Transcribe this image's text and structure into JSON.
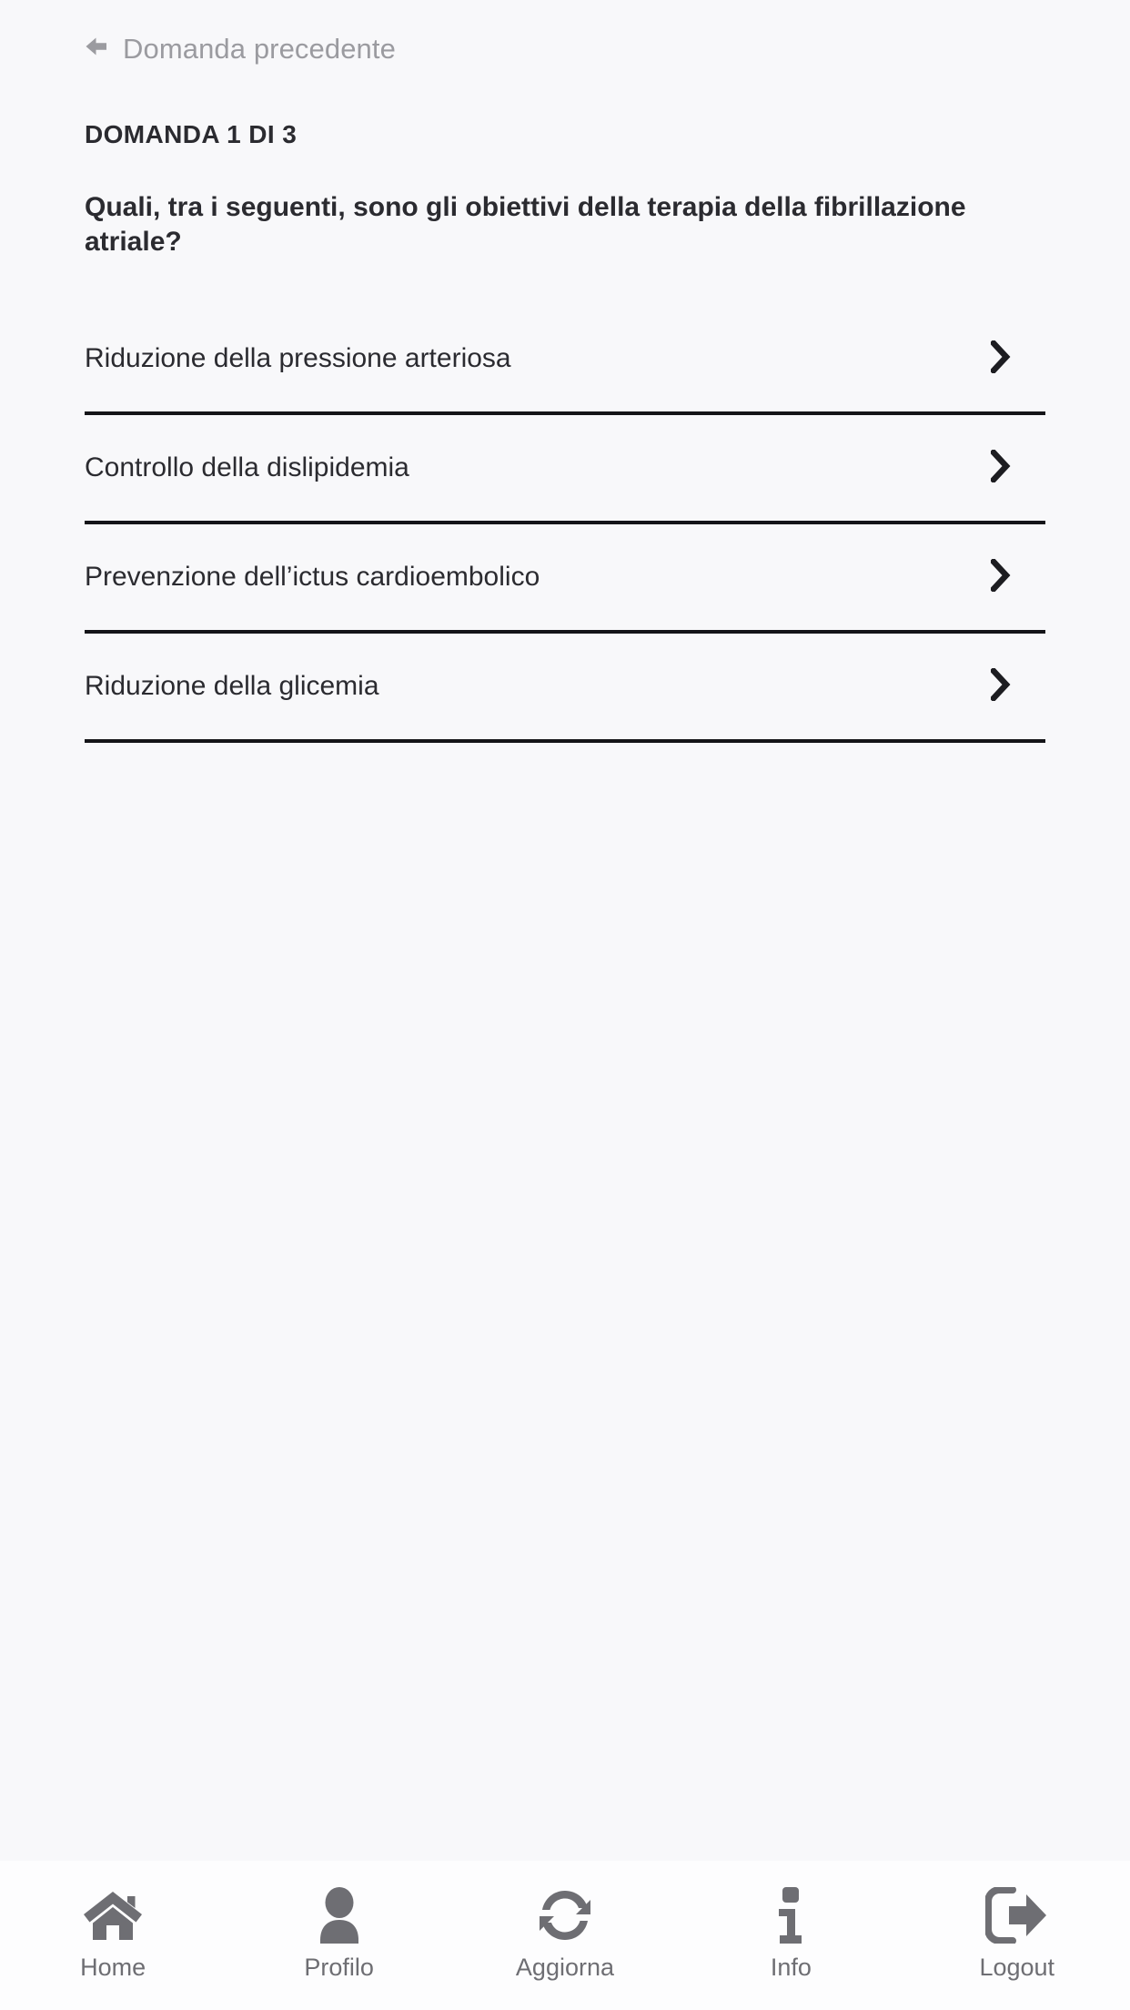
{
  "header": {
    "back_icon": "arrow-left-icon",
    "back_label": "Domanda precedente"
  },
  "question": {
    "counter": "DOMANDA 1 DI 3",
    "text": "Quali, tra i seguenti, sono gli obiettivi della terapia della fibrillazione atriale?"
  },
  "options": [
    {
      "label": "Riduzione della pressione arteriosa",
      "chevron_icon": "chevron-right-icon"
    },
    {
      "label": "Controllo della dislipidemia",
      "chevron_icon": "chevron-right-icon"
    },
    {
      "label": "Prevenzione dell’ictus cardioembolico",
      "chevron_icon": "chevron-right-icon"
    },
    {
      "label": "Riduzione della glicemia",
      "chevron_icon": "chevron-right-icon"
    }
  ],
  "bottom_nav": [
    {
      "label": "Home",
      "icon": "home-icon"
    },
    {
      "label": "Profilo",
      "icon": "person-icon"
    },
    {
      "label": "Aggiorna",
      "icon": "refresh-icon"
    },
    {
      "label": "Info",
      "icon": "info-icon"
    },
    {
      "label": "Logout",
      "icon": "logout-icon"
    }
  ],
  "colors": {
    "background": "#f8f8fa",
    "nav_background": "#fdfdfe",
    "text_primary": "#2b2b30",
    "text_muted": "#9b9ba0",
    "nav_icon": "#6e6e73",
    "divider": "#141418"
  }
}
